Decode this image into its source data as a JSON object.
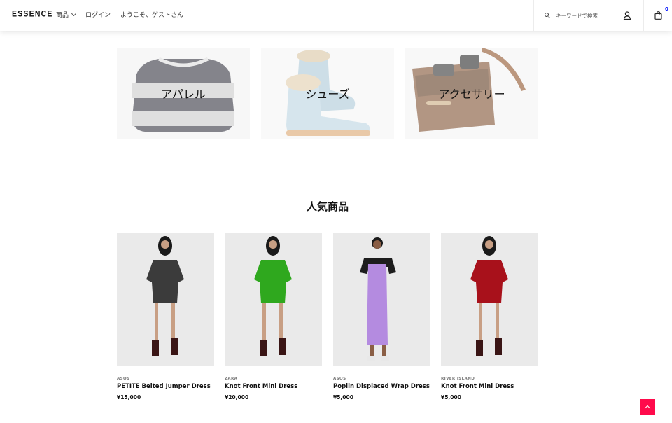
{
  "header": {
    "logo": "ESSENCE",
    "nav": {
      "products": "商品",
      "login": "ログイン",
      "greeting": "ようこそ、ゲストさん"
    },
    "search": {
      "placeholder": "キーワードで検索",
      "icon": "search-icon"
    },
    "user_icon": "user-icon",
    "cart": {
      "icon": "bag-icon",
      "count": "0"
    }
  },
  "categories": [
    {
      "label": "アパレル"
    },
    {
      "label": "シューズ"
    },
    {
      "label": "アクセサリー"
    }
  ],
  "popular": {
    "title": "人気商品",
    "products": [
      {
        "brand": "ASOS",
        "name": "PETITE Belted Jumper Dress",
        "price": "¥15,000",
        "dress_color": "#3b3b3b"
      },
      {
        "brand": "ZARA",
        "name": "Knot Front Mini Dress",
        "price": "¥20,000",
        "dress_color": "#2fa81e"
      },
      {
        "brand": "ASOS",
        "name": "Poplin Displaced Wrap Dress",
        "price": "¥5,000",
        "dress_color": "#b48be0"
      },
      {
        "brand": "RIVER ISLAND",
        "name": "Knot Front Mini Dress",
        "price": "¥5,000",
        "dress_color": "#a8111b"
      }
    ]
  },
  "colors": {
    "accent": "#ff0a4b",
    "cart_count": "#0315ff"
  },
  "back_to_top_icon": "arrow-up-icon"
}
